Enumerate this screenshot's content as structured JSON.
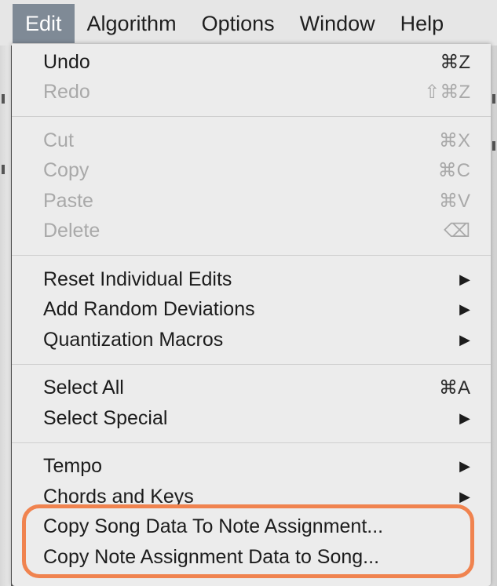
{
  "menubar": {
    "items": [
      {
        "label": "Edit",
        "active": true
      },
      {
        "label": "Algorithm"
      },
      {
        "label": "Options"
      },
      {
        "label": "Window"
      },
      {
        "label": "Help"
      }
    ]
  },
  "menu": {
    "group1": [
      {
        "label": "Undo",
        "shortcut": "⌘Z",
        "enabled": true
      },
      {
        "label": "Redo",
        "shortcut": "⇧⌘Z",
        "enabled": false
      }
    ],
    "group2": [
      {
        "label": "Cut",
        "shortcut": "⌘X",
        "enabled": false
      },
      {
        "label": "Copy",
        "shortcut": "⌘C",
        "enabled": false
      },
      {
        "label": "Paste",
        "shortcut": "⌘V",
        "enabled": false
      },
      {
        "label": "Delete",
        "shortcut": "⌫",
        "enabled": false
      }
    ],
    "group3": [
      {
        "label": "Reset Individual Edits",
        "submenu_icon": "▶"
      },
      {
        "label": "Add Random Deviations",
        "submenu_icon": "▶"
      },
      {
        "label": "Quantization Macros",
        "submenu_icon": "▶"
      }
    ],
    "group4": [
      {
        "label": "Select All",
        "shortcut": "⌘A"
      },
      {
        "label": "Select Special",
        "submenu_icon": "▶"
      }
    ],
    "group5": [
      {
        "label": "Tempo",
        "submenu_icon": "▶"
      },
      {
        "label": "Chords and Keys",
        "submenu_icon": "▶"
      },
      {
        "label": "Copy Song Data To Note Assignment..."
      },
      {
        "label": "Copy Note Assignment Data to Song..."
      }
    ]
  },
  "colors": {
    "highlight": "#f0834f",
    "active_menu": "#7f8a96"
  }
}
